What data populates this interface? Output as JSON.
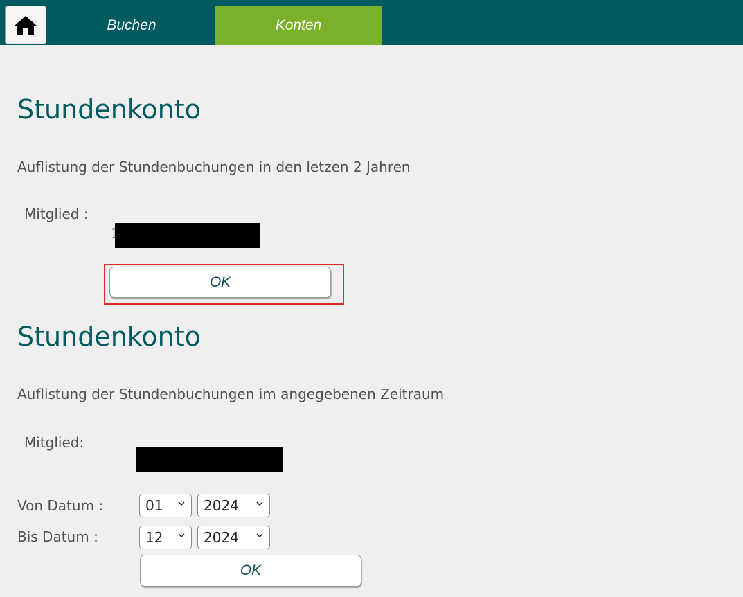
{
  "nav": {
    "home_icon": "home-icon",
    "tabs": [
      {
        "label": "Buchen"
      },
      {
        "label": "Konten",
        "active": true
      }
    ],
    "active_color": "#7ab02a",
    "bar_color": "#005a5f"
  },
  "section1": {
    "title": "Stundenkonto",
    "description": "Auflistung der Stundenbuchungen in den letzen 2 Jahren",
    "member_label": "Mitglied :",
    "member_value_stray": "1",
    "ok_label": "OK"
  },
  "section2": {
    "title": "Stundenkonto",
    "description": "Auflistung der Stundenbuchungen im angegebenen Zeitraum",
    "member_label": "Mitglied:",
    "from_label": "Von Datum :",
    "to_label": "Bis Datum :",
    "from_month": "01",
    "from_year": "2024",
    "to_month": "12",
    "to_year": "2024",
    "ok_label": "OK"
  }
}
